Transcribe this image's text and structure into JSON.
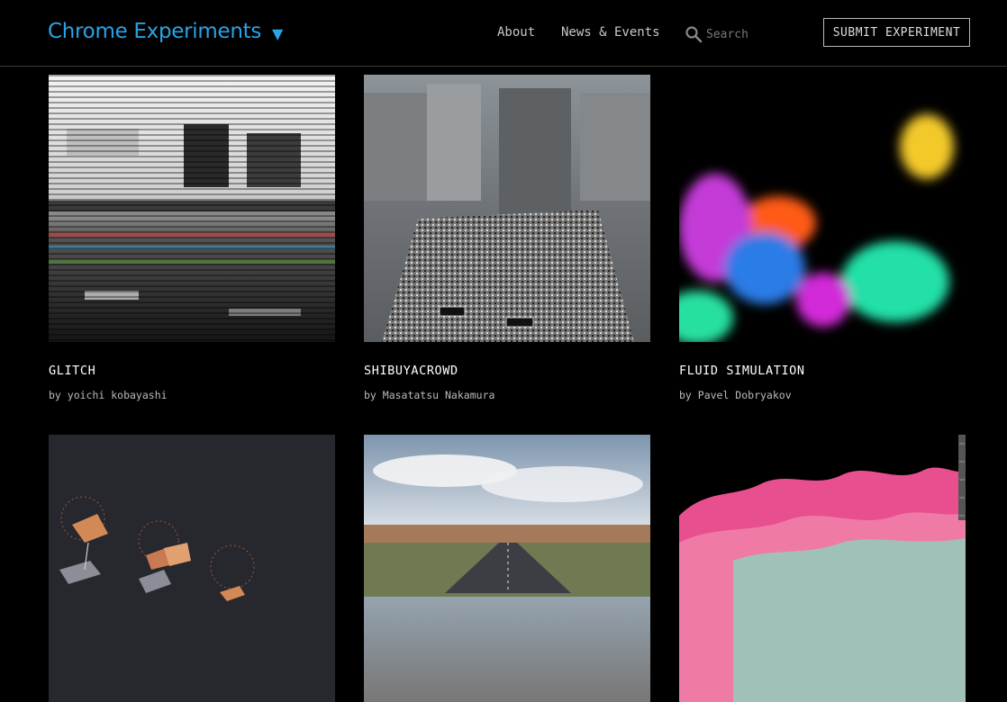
{
  "header": {
    "brand": "Chrome Experiments",
    "brand_caret": "▼",
    "nav": {
      "about": "About",
      "news": "News & Events"
    },
    "search_placeholder": "Search",
    "submit_label": "SUBMIT EXPERIMENT"
  },
  "experiments": [
    {
      "title": "GLITCH",
      "author": "by yoichi kobayashi"
    },
    {
      "title": "SHIBUYACROWD",
      "author": "by Masatatsu Nakamura"
    },
    {
      "title": "FLUID SIMULATION",
      "author": "by Pavel Dobryakov"
    },
    {
      "title": "",
      "author": ""
    },
    {
      "title": "",
      "author": ""
    },
    {
      "title": "",
      "author": ""
    }
  ],
  "colors": {
    "brand": "#2aa3e6",
    "background": "#000000"
  },
  "icons": {
    "search": "search-icon",
    "caret": "caret-down-icon"
  }
}
